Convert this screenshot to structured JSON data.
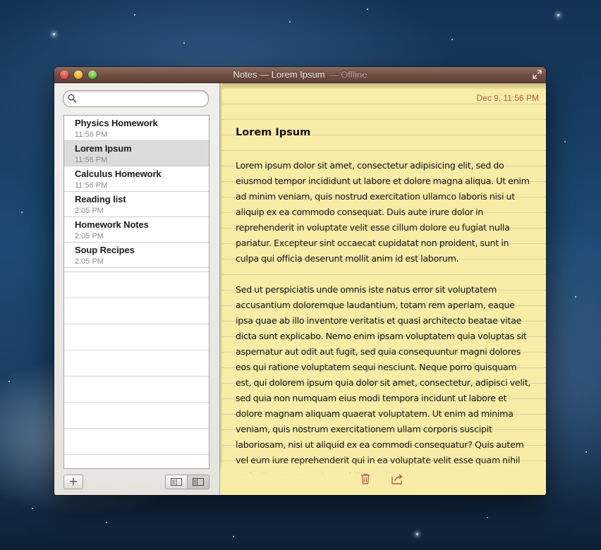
{
  "window": {
    "app_title": "Notes — Lorem Ipsum",
    "status": "— Offline"
  },
  "search": {
    "value": "",
    "placeholder": ""
  },
  "notes": [
    {
      "title": "Physics Homework",
      "time": "11:56 PM"
    },
    {
      "title": "Lorem Ipsum",
      "time": "11:56 PM",
      "selected": true
    },
    {
      "title": "Calculus Homework",
      "time": "11:56 PM"
    },
    {
      "title": "Reading list",
      "time": "2:05 PM"
    },
    {
      "title": "Homework Notes",
      "time": "2:05 PM"
    },
    {
      "title": "Soup Recipes",
      "time": "2:05 PM"
    }
  ],
  "sidebar_footer": {
    "add_label": "+"
  },
  "note": {
    "date": "Dec 9, 11:56 PM",
    "heading": "Lorem Ipsum",
    "paragraphs": [
      "Lorem ipsum dolor sit amet, consectetur adipisicing elit, sed do eiusmod tempor incididunt ut labore et dolore magna aliqua. Ut enim ad minim veniam, quis nostrud exercitation ullamco laboris nisi ut aliquip ex ea commodo consequat. Duis aute irure dolor in reprehenderit in voluptate velit esse cillum dolore eu fugiat nulla pariatur. Excepteur sint occaecat cupidatat non proident, sunt in culpa qui officia deserunt mollit anim id est laborum.",
      "Sed ut perspiciatis unde omnis iste natus error sit voluptatem accusantium doloremque laudantium, totam rem aperiam, eaque ipsa quae ab illo inventore veritatis et quasi architecto beatae vitae dicta sunt explicabo. Nemo enim ipsam voluptatem quia voluptas sit aspernatur aut odit aut fugit, sed quia consequuntur magni dolores eos qui ratione voluptatem sequi nesciunt. Neque porro quisquam est, qui dolorem ipsum quia dolor sit amet, consectetur, adipisci velit, sed quia non numquam eius modi tempora incidunt ut labore et dolore magnam aliquam quaerat voluptatem. Ut enim ad minima veniam, quis nostrum exercitationem ullam corporis suscipit laboriosam, nisi ut aliquid ex ea commodi consequatur? Quis autem vel eum iure reprehenderit qui in ea voluptate velit esse quam nihil molestiae consequatur, vel illum qui"
    ]
  },
  "icons": {
    "close": "close-traffic-light",
    "minimize": "minimize-traffic-light",
    "zoom": "zoom-traffic-light",
    "fullscreen": "fullscreen-arrows-icon",
    "search": "magnifier-icon",
    "trash": "trash-icon",
    "share": "share-icon",
    "list_view": "list-view-icon",
    "split_view": "split-view-icon"
  },
  "colors": {
    "titlebar": "#6e4e42",
    "paper": "#f7eda6",
    "date_text": "#b9574a",
    "selected_row": "#dcdcdc"
  }
}
